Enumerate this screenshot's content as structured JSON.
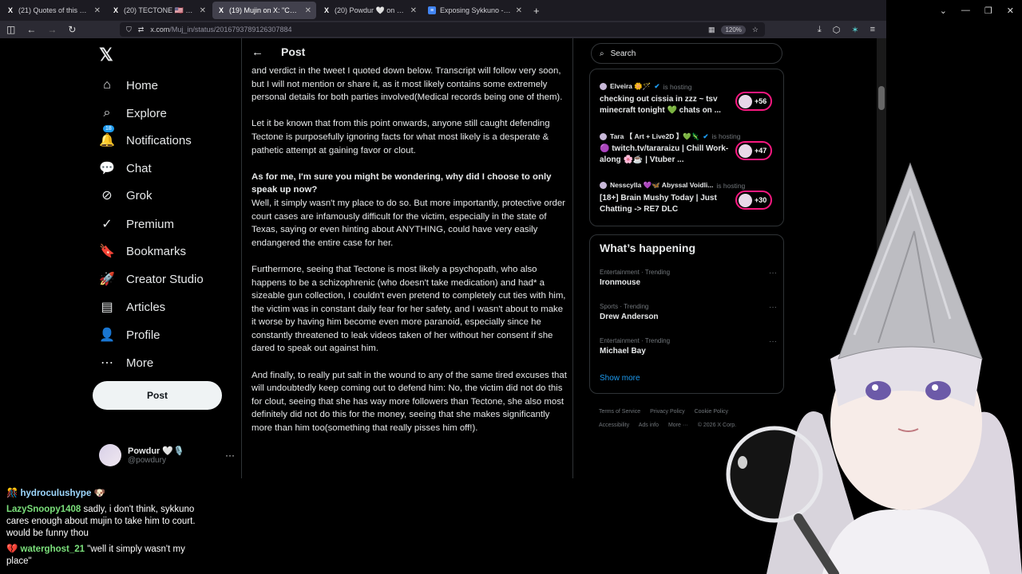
{
  "browser": {
    "tabs": [
      {
        "fav": "X",
        "title": "(21) Quotes of this post / X",
        "active": false
      },
      {
        "fav": "X",
        "title": "(20) TECTONE 🇺🇸 on X: \"Cutting",
        "active": false
      },
      {
        "fav": "X",
        "title": "(19) Mujin on X: \"Cutting all ties",
        "active": true
      },
      {
        "fav": "X",
        "title": "(20) Powdur 🤍 on X: \"Bao,",
        "active": false
      },
      {
        "fav": "≡",
        "title": "Exposing Sykkuno - Google Do",
        "active": false
      }
    ],
    "url_main": "x.com",
    "url_path": "/Muj_in/status/2016793789126307884",
    "zoom": "120%"
  },
  "sidebar": {
    "logo": "𝕏",
    "items": [
      {
        "icon": "⌂",
        "label": "Home"
      },
      {
        "icon": "⌕",
        "label": "Explore"
      },
      {
        "icon": "🔔",
        "label": "Notifications",
        "badge": "18"
      },
      {
        "icon": "💬",
        "label": "Chat"
      },
      {
        "icon": "⊘",
        "label": "Grok"
      },
      {
        "icon": "✓",
        "label": "Premium"
      },
      {
        "icon": "🔖",
        "label": "Bookmarks"
      },
      {
        "icon": "🚀",
        "label": "Creator Studio"
      },
      {
        "icon": "▤",
        "label": "Articles"
      },
      {
        "icon": "👤",
        "label": "Profile"
      },
      {
        "icon": "⋯",
        "label": "More"
      }
    ],
    "post_label": "Post",
    "account": {
      "name": "Powdur 🤍🎙️",
      "handle": "@powdury"
    }
  },
  "main": {
    "back": "←",
    "title": "Post",
    "p1": "and verdict in the tweet I quoted down below. Transcript will follow very soon, but I will not mention or share it, as it most likely contains some extremely personal details for both parties involved(Medical records being one of them).",
    "p2": "Let it be known that from this point onwards, anyone still caught defending Tectone is purposefully ignoring facts for what most likely is a desperate & pathetic attempt at gaining favor or clout.",
    "p3_bold": "As for me, I'm sure you might be wondering, why did I choose to only speak up now?",
    "p3": "Well, it simply wasn't my place to do so. But more importantly, protective order court cases are infamously difficult for the victim, especially in the state of Texas, saying or even hinting about ANYTHING, could have very easily endangered the entire case for her.",
    "p4": "Furthermore, seeing that Tectone is most likely a psychopath, who also happens to be a schizophrenic (who doesn't take medication) and had* a sizeable gun collection, I couldn't even pretend to completely cut ties with him, the victim was in constant daily fear for her safety, and I wasn't about to make it worse by having him become even more paranoid, especially since he constantly threatened to leak videos taken of her without her consent if she dared to speak out against him.",
    "p5": "And finally, to really put salt in the wound to any of the same tired excuses that will undoubtedly keep coming out to defend him: No, the victim did not do this for clout, seeing that she has way more followers than Tectone, she also most definitely did not do this for the money, seeing that she makes significantly more than him too(something that really pisses him off!)."
  },
  "right": {
    "search_placeholder": "Search",
    "live": [
      {
        "host": "Elveira 🌼🪄",
        "hosting": "is hosting",
        "title": "checking out cissia in zzz ~ tsv minecraft tonight 💚 chats on ...",
        "count": "+56"
      },
      {
        "host": "Tara 【 Art + Live2D 】💚🦎",
        "hosting": "is hosting",
        "title": "🟣 twitch.tv/tararaizu | Chill Work-along 🌸☕ | Vtuber ...",
        "count": "+47"
      },
      {
        "host": "Nesscylla 💜🦋 Abyssal Voidli...",
        "hosting": "is hosting",
        "title": "[18+] Brain Mushy Today | Just Chatting -> RE7 DLC",
        "count": "+30"
      }
    ],
    "happening_title": "What’s happening",
    "trends": [
      {
        "category": "Entertainment · Trending",
        "name": "Ironmouse"
      },
      {
        "category": "Sports · Trending",
        "name": "Drew Anderson"
      },
      {
        "category": "Entertainment · Trending",
        "name": "Michael Bay"
      }
    ],
    "show_more": "Show more",
    "footer": [
      "Terms of Service",
      "Privacy Policy",
      "Cookie Policy",
      "Accessibility",
      "Ads info",
      "More ···",
      "© 2026 X Corp."
    ]
  },
  "chat": {
    "messages": [
      {
        "user": "🎊 hydroculushype",
        "text": "🐶"
      },
      {
        "user": "LazySnoopy1408",
        "text": "sadly, i don't think, sykkuno cares enough about mujin to take him to court. would be funny thou"
      },
      {
        "user": "💔 waterghost_21",
        "text": "\"well it simply wasn't my place\""
      }
    ]
  }
}
